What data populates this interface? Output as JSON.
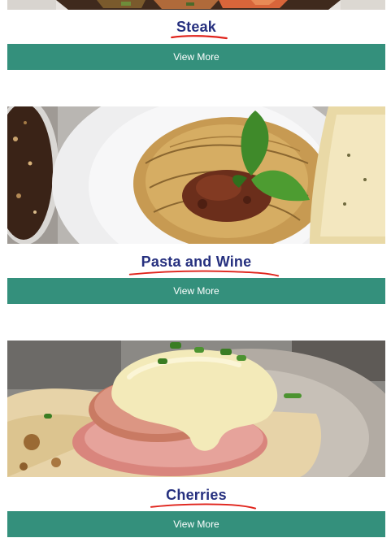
{
  "cards": [
    {
      "title": "Steak",
      "button_label": "View More",
      "image": "steak-dish-photo"
    },
    {
      "title": "Pasta and Wine",
      "button_label": "View More",
      "image": "spaghetti-bolognese-photo"
    },
    {
      "title": "Cherries",
      "button_label": "View More",
      "image": "eggs-benedict-photo"
    }
  ],
  "colors": {
    "title": "#26307f",
    "button": "#34907c",
    "underline_annotation": "#e0231b"
  }
}
